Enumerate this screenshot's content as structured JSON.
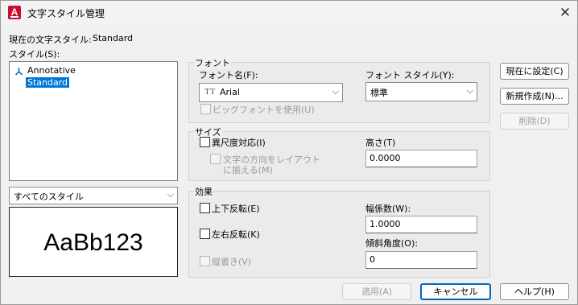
{
  "window": {
    "title": "文字スタイル管理",
    "close_glyph": "✕",
    "app_icon_letter": "A"
  },
  "current_style": {
    "label": "現在の文字スタイル:",
    "value": "Standard"
  },
  "styles": {
    "label": "スタイル(S):",
    "items": [
      {
        "name": "Annotative",
        "icon": "annotative-icon",
        "selected": false
      },
      {
        "name": "Standard",
        "selected": true
      }
    ],
    "filter_value": "すべてのスタイル",
    "preview_text": "AaBb123"
  },
  "font": {
    "group_label": "フォント",
    "name_label": "フォント名(F):",
    "name_value": "Arial",
    "truetype_icon": "TT",
    "style_label": "フォント スタイル(Y):",
    "style_value": "標準",
    "bigfont_label": "ビッグフォントを使用(U)"
  },
  "size": {
    "group_label": "サイズ",
    "annotative_label": "異尺度対応(I)",
    "match_layout_line1": "文字の方向をレイアウト",
    "match_layout_line2": "に揃える(M)",
    "height_label": "高さ(T)",
    "height_value": "0.0000"
  },
  "effects": {
    "group_label": "効果",
    "upside_down_label": "上下反転(E)",
    "backwards_label": "左右反転(K)",
    "vertical_label": "縦書き(V)",
    "width_label": "幅係数(W):",
    "width_value": "1.0000",
    "oblique_label": "傾斜角度(O):",
    "oblique_value": "0"
  },
  "buttons": {
    "set_current": "現在に設定(C)",
    "new": "新規作成(N)...",
    "delete": "削除(D)",
    "apply": "適用(A)",
    "cancel": "キャンセル",
    "help": "ヘルプ(H)"
  },
  "colors": {
    "accent": "#0078d7",
    "primary_border": "#0067c0",
    "app_icon": "#c8102e"
  }
}
